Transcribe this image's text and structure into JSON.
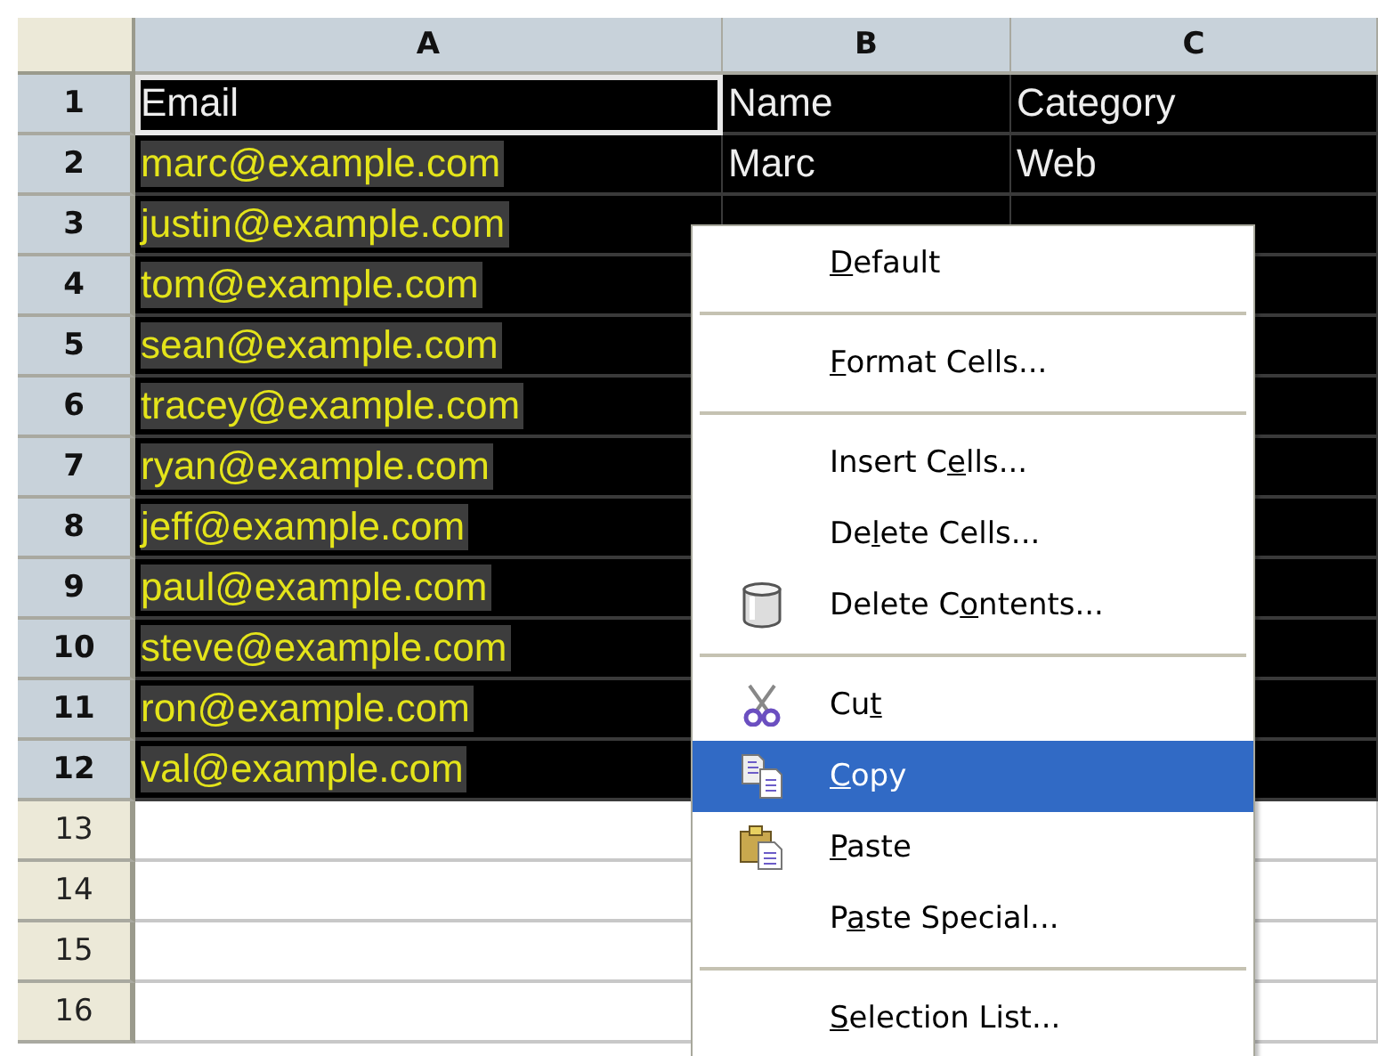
{
  "columns": [
    {
      "label": "A",
      "selected": true
    },
    {
      "label": "B",
      "selected": true
    },
    {
      "label": "C",
      "selected": true
    }
  ],
  "rows": [
    {
      "number": "1",
      "selected": true,
      "cells": [
        "Email",
        "Name",
        "Category"
      ],
      "active_cell": true
    },
    {
      "number": "2",
      "selected": true,
      "cells": [
        "marc@example.com",
        "Marc",
        "Web"
      ]
    },
    {
      "number": "3",
      "selected": true,
      "cells": [
        "justin@example.com"
      ]
    },
    {
      "number": "4",
      "selected": true,
      "cells": [
        "tom@example.com"
      ]
    },
    {
      "number": "5",
      "selected": true,
      "cells": [
        "sean@example.com"
      ]
    },
    {
      "number": "6",
      "selected": true,
      "cells": [
        "tracey@example.com"
      ]
    },
    {
      "number": "7",
      "selected": true,
      "cells": [
        "ryan@example.com"
      ]
    },
    {
      "number": "8",
      "selected": true,
      "cells": [
        "jeff@example.com"
      ]
    },
    {
      "number": "9",
      "selected": true,
      "cells": [
        "paul@example.com"
      ]
    },
    {
      "number": "10",
      "selected": true,
      "cells": [
        "steve@example.com"
      ]
    },
    {
      "number": "11",
      "selected": true,
      "cells": [
        "ron@example.com"
      ]
    },
    {
      "number": "12",
      "selected": true,
      "cells": [
        "val@example.com"
      ]
    },
    {
      "number": "13",
      "selected": false
    },
    {
      "number": "14",
      "selected": false
    },
    {
      "number": "15",
      "selected": false
    },
    {
      "number": "16",
      "selected": false
    }
  ],
  "context_menu": [
    {
      "kind": "item",
      "mnemonic": "D",
      "label_rest": "efault",
      "selected": false
    },
    {
      "kind": "separator"
    },
    {
      "kind": "item",
      "mnemonic": "F",
      "label_rest": "ormat Cells...",
      "selected": false
    },
    {
      "kind": "separator"
    },
    {
      "kind": "item",
      "label_start": "Insert C",
      "mnemonic": "e",
      "label_rest": "lls...",
      "selected": false
    },
    {
      "kind": "item",
      "label_start": "De",
      "mnemonic": "l",
      "label_rest": "ete Cells...",
      "selected": false
    },
    {
      "kind": "item",
      "label_start": "Delete C",
      "mnemonic": "o",
      "label_rest": "ntents...",
      "selected": false
    },
    {
      "kind": "separator"
    },
    {
      "kind": "item",
      "label_start": "Cu",
      "mnemonic": "t",
      "selected": false
    },
    {
      "kind": "item",
      "mnemonic": "C",
      "label_rest": "opy",
      "selected": true
    },
    {
      "kind": "item",
      "mnemonic": "P",
      "label_rest": "aste",
      "selected": false
    },
    {
      "kind": "item",
      "label_start": "P",
      "mnemonic": "a",
      "label_rest": "ste Special...",
      "selected": false
    },
    {
      "kind": "separator"
    },
    {
      "kind": "item",
      "mnemonic": "S",
      "label_rest": "election List...",
      "selected": false
    }
  ]
}
